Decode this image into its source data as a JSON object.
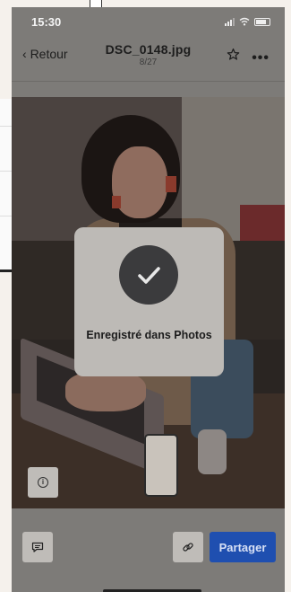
{
  "status_bar": {
    "time": "15:30"
  },
  "nav": {
    "back_label": "Retour",
    "file_title": "DSC_0148.jpg",
    "file_position": "8/27",
    "more_label": "•••"
  },
  "toast": {
    "message": "Enregistré dans Photos"
  },
  "photo": {
    "info_symbol": "i"
  },
  "toolbar": {
    "share_label": "Partager"
  },
  "colors": {
    "share_button": "#1f4fb0",
    "toast_background": "#bdbab6",
    "check_circle": "#3b3b3d"
  }
}
